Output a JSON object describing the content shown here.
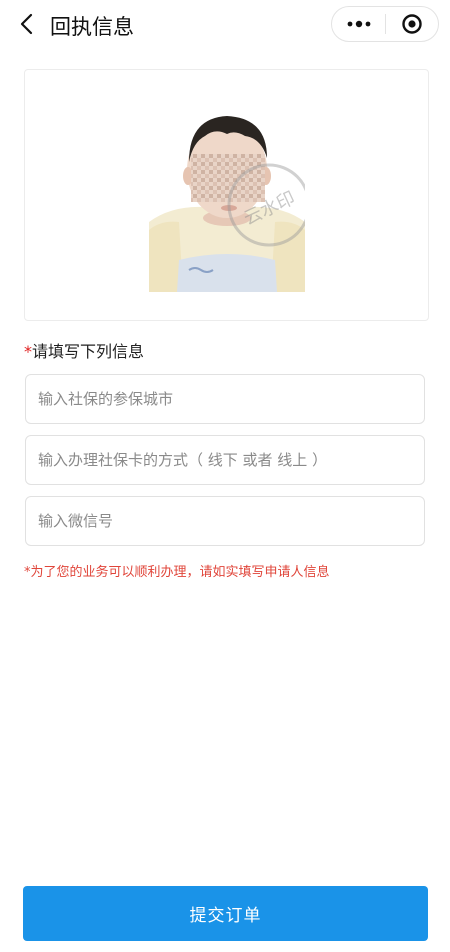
{
  "header": {
    "title": "回执信息"
  },
  "photo": {
    "watermark_text": "云水印"
  },
  "form": {
    "section_label": "请填写下列信息",
    "required_mark": "*",
    "fields": [
      {
        "placeholder": "输入社保的参保城市",
        "value": ""
      },
      {
        "placeholder": "输入办理社保卡的方式（ 线下 或者 线上 ）",
        "value": ""
      },
      {
        "placeholder": "输入微信号",
        "value": ""
      }
    ],
    "note": "*为了您的业务可以顺利办理，请如实填写申请人信息"
  },
  "actions": {
    "submit_label": "提交订单"
  },
  "colors": {
    "accent": "#1a93e8",
    "required": "#e02020",
    "note": "#e0453a"
  }
}
